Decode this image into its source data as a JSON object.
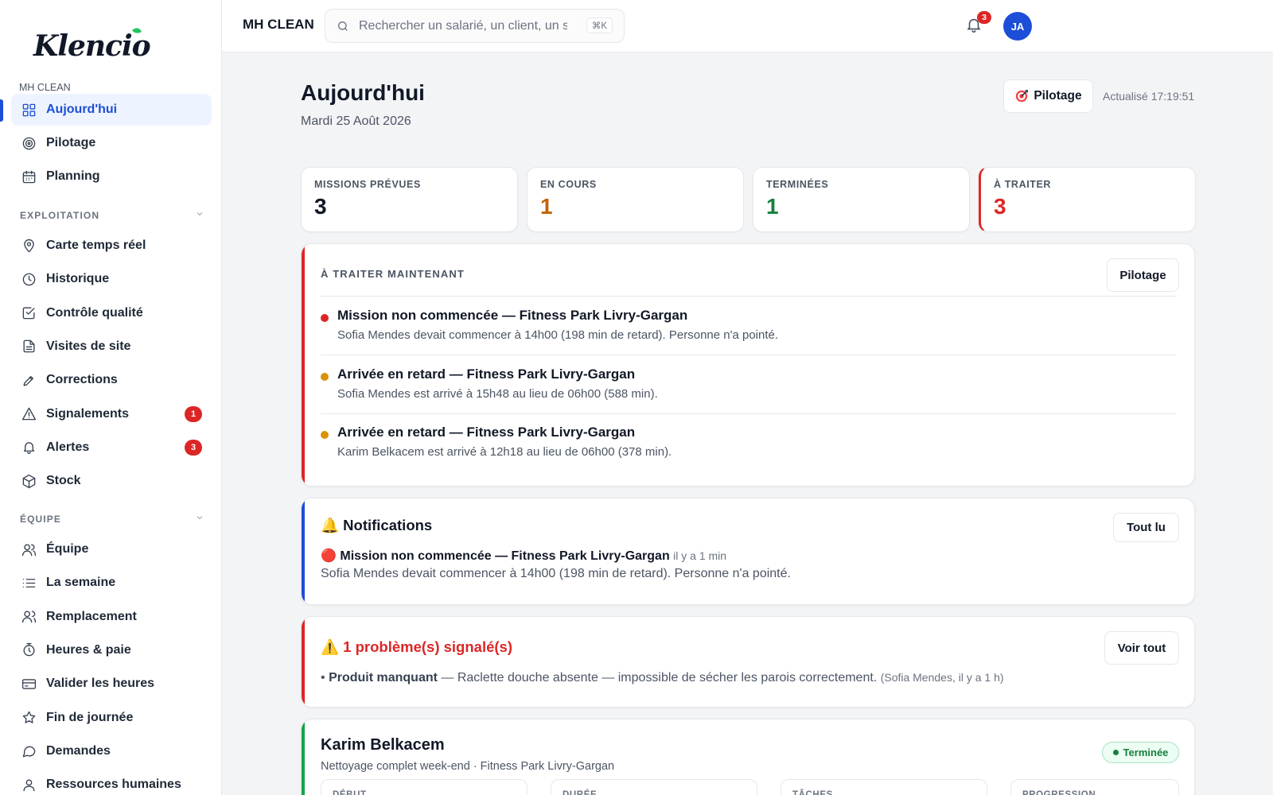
{
  "brand": {
    "logo_text": "Klencio",
    "org_label": "MH CLEAN"
  },
  "sidebar": {
    "top_items": [
      {
        "label": "Aujourd'hui",
        "icon": "grid-icon",
        "active": true
      },
      {
        "label": "Pilotage",
        "icon": "target-icon"
      },
      {
        "label": "Planning",
        "icon": "calendar-icon"
      }
    ],
    "sections": [
      {
        "title": "EXPLOITATION",
        "items": [
          {
            "label": "Carte temps réel",
            "icon": "map-pin-icon"
          },
          {
            "label": "Historique",
            "icon": "clock-icon"
          },
          {
            "label": "Contrôle qualité",
            "icon": "check-square-icon"
          },
          {
            "label": "Visites de site",
            "icon": "file-icon"
          },
          {
            "label": "Corrections",
            "icon": "pen-icon"
          },
          {
            "label": "Signalements",
            "icon": "warning-icon",
            "badge": "1"
          },
          {
            "label": "Alertes",
            "icon": "bell-icon",
            "badge": "3"
          },
          {
            "label": "Stock",
            "icon": "box-icon"
          }
        ]
      },
      {
        "title": "ÉQUIPE",
        "items": [
          {
            "label": "Équipe",
            "icon": "users-icon"
          },
          {
            "label": "La semaine",
            "icon": "list-icon"
          },
          {
            "label": "Remplacement",
            "icon": "users-swap-icon"
          },
          {
            "label": "Heures & paie",
            "icon": "stopwatch-icon"
          },
          {
            "label": "Valider les heures",
            "icon": "credit-card-icon"
          },
          {
            "label": "Fin de journée",
            "icon": "star-icon"
          },
          {
            "label": "Demandes",
            "icon": "message-icon"
          },
          {
            "label": "Ressources humaines",
            "icon": "user-icon"
          }
        ]
      }
    ]
  },
  "topbar": {
    "org_title": "MH CLEAN",
    "search_placeholder": "Rechercher un salarié, un client, un si",
    "search_shortcut": "⌘K",
    "notif_count": "3",
    "avatar_initials": "JA"
  },
  "header": {
    "title": "Aujourd'hui",
    "date": "Mardi 25 Août 2026",
    "pilotage_label": "Pilotage",
    "updated": "Actualisé 17:19:51"
  },
  "stats": [
    {
      "label": "MISSIONS PRÉVUES",
      "value": "3",
      "color": "#111827"
    },
    {
      "label": "EN COURS",
      "value": "1",
      "color": "#c2620a"
    },
    {
      "label": "TERMINÉES",
      "value": "1",
      "color": "#15803d"
    },
    {
      "label": "À TRAITER",
      "value": "3",
      "color": "#dc2626"
    }
  ],
  "to_treat": {
    "title": "À TRAITER MAINTENANT",
    "button": "Pilotage",
    "items": [
      {
        "title": "Mission non commencée — Fitness Park Livry-Gargan",
        "desc": "Sofia Mendes devait commencer à 14h00 (198 min de retard). Personne n'a pointé.",
        "color": "#dc2626"
      },
      {
        "title": "Arrivée en retard — Fitness Park Livry-Gargan",
        "desc": "Sofia Mendes est arrivé à 15h48 au lieu de 06h00 (588 min).",
        "color": "#d99206"
      },
      {
        "title": "Arrivée en retard — Fitness Park Livry-Gargan",
        "desc": "Karim Belkacem est arrivé à 12h18 au lieu de 06h00 (378 min).",
        "color": "#d99206"
      }
    ]
  },
  "notifications": {
    "title": "🔔 Notifications",
    "button": "Tout lu",
    "item": {
      "icon": "🔴",
      "title": "Mission non commencée — Fitness Park Livry-Gargan",
      "when": "il y a 1 min",
      "desc": "Sofia Mendes devait commencer à 14h00 (198 min de retard). Personne n'a pointé."
    }
  },
  "problems": {
    "title": "⚠️ 1 problème(s) signalé(s)",
    "button": "Voir tout",
    "item": {
      "bullet": "•",
      "name": "Produit manquant",
      "desc": " — Raclette douche absente — impossible de sécher les parois correctement.",
      "meta": "(Sofia Mendes, il y a 1 h)"
    }
  },
  "employee": {
    "name": "Karim Belkacem",
    "sub": "Nettoyage complet week-end · Fitness Park Livry-Gargan",
    "status": "Terminée",
    "metrics": [
      "DÉBUT",
      "DURÉE",
      "TÂCHES",
      "PROGRESSION"
    ]
  }
}
